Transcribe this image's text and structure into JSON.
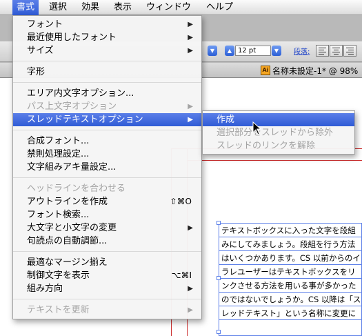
{
  "menubar": {
    "items": [
      {
        "label": "書式",
        "active": true
      },
      {
        "label": "選択",
        "active": false
      },
      {
        "label": "効果",
        "active": false
      },
      {
        "label": "表示",
        "active": false
      },
      {
        "label": "ウィンドウ",
        "active": false
      },
      {
        "label": "ヘルプ",
        "active": false
      }
    ]
  },
  "control_bar": {
    "font_size": "12 pt",
    "paragraph_label": "段落:"
  },
  "document": {
    "title": "名称未設定-1* @ 98%",
    "left_tab_fragment": "未設",
    "icon_label": "Ai"
  },
  "menu": {
    "items": [
      {
        "label": "フォント",
        "disabled": false,
        "submenu": true
      },
      {
        "label": "最近使用したフォント",
        "disabled": false,
        "submenu": true
      },
      {
        "label": "サイズ",
        "disabled": false,
        "submenu": true
      },
      {
        "label": "字形",
        "disabled": false,
        "submenu": false
      },
      {
        "label": "エリア内文字オプション...",
        "disabled": false,
        "submenu": false
      },
      {
        "label": "パス上文字オプション",
        "disabled": true,
        "submenu": true
      },
      {
        "label": "スレッドテキストオプション",
        "disabled": false,
        "submenu": true,
        "highlighted": true
      },
      {
        "label": "合成フォント...",
        "disabled": false,
        "submenu": false
      },
      {
        "label": "禁則処理設定...",
        "disabled": false,
        "submenu": false
      },
      {
        "label": "文字組みアキ量設定...",
        "disabled": false,
        "submenu": false
      },
      {
        "label": "ヘッドラインを合わせる",
        "disabled": true,
        "submenu": false
      },
      {
        "label": "アウトラインを作成",
        "disabled": false,
        "submenu": false,
        "shortcut": "⇧⌘O"
      },
      {
        "label": "フォント検索...",
        "disabled": false,
        "submenu": false
      },
      {
        "label": "大文字と小文字の変更",
        "disabled": false,
        "submenu": true
      },
      {
        "label": "句読点の自動調節...",
        "disabled": false,
        "submenu": false
      },
      {
        "label": "最適なマージン揃え",
        "disabled": false,
        "submenu": false
      },
      {
        "label": "制御文字を表示",
        "disabled": false,
        "submenu": false,
        "shortcut": "⌥⌘I"
      },
      {
        "label": "組み方向",
        "disabled": false,
        "submenu": true
      },
      {
        "label": "テキストを更新",
        "disabled": true,
        "submenu": true
      }
    ]
  },
  "submenu": {
    "items": [
      {
        "label": "作成",
        "disabled": false,
        "highlighted": true
      },
      {
        "label": "選択部分をスレッドから除外",
        "disabled": true
      },
      {
        "label": "スレッドのリンクを解除",
        "disabled": true
      }
    ]
  },
  "text_frame": {
    "lines": [
      "テキストボックスに入った文字を段組",
      "みにしてみましょう。段組を行う方法",
      "はいくつかあります。CS 以前からのイ",
      "ラレユーザーはテキストボックスをリ",
      "ンクさせる方法を用いる事が多かった",
      "のではないでしょうか。CS 以降は「ス",
      "レッドテキスト」という名称に変更に"
    ]
  },
  "colors": {
    "highlight": "#2f5bd6",
    "guide": "#cc2a2a",
    "frame": "#5b7fe8"
  }
}
